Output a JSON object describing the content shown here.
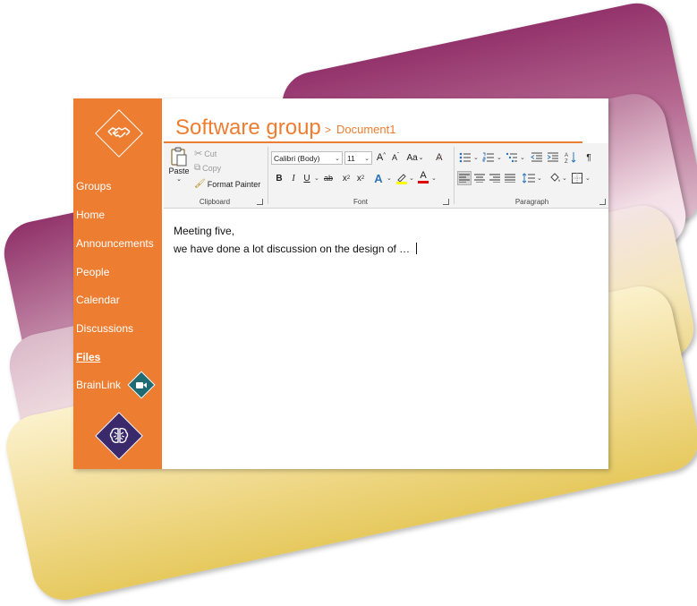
{
  "app": {
    "title": "Software group",
    "breadcrumb_sep": ">",
    "document": "Document1"
  },
  "sidebar": {
    "items": [
      {
        "label": "Groups"
      },
      {
        "label": "Home"
      },
      {
        "label": "Announcements"
      },
      {
        "label": "People"
      },
      {
        "label": "Calendar"
      },
      {
        "label": "Discussions"
      },
      {
        "label": "Files",
        "active": true
      },
      {
        "label": "BrainLink"
      }
    ],
    "top_logo_icon": "handshake-icon",
    "bottom_logo_icon": "brain-icon",
    "brainlink_badge_icon": "video-camera-icon"
  },
  "ribbon": {
    "clipboard": {
      "label": "Clipboard",
      "paste": "Paste",
      "cut": "Cut",
      "copy": "Copy",
      "format_painter": "Format Painter"
    },
    "font": {
      "label": "Font",
      "font_name": "Calibri (Body)",
      "font_size": "11",
      "bold": "B",
      "italic": "I",
      "underline": "U",
      "strikethrough": "ab",
      "subscript": "x",
      "superscript": "x",
      "change_case": "Aa",
      "text_effects": "A",
      "font_color": "A"
    },
    "paragraph": {
      "label": "Paragraph",
      "pilcrow": "¶"
    }
  },
  "document": {
    "lines": [
      "Meeting five,",
      "we have done a lot discussion on the design of … "
    ]
  },
  "colors": {
    "accent": "#ed7d31",
    "sidebar": "#ed7d31",
    "brain_logo": "#3b2a6b",
    "brainlink_badge": "#1f6b73",
    "card_plum": "#93336c",
    "card_gold": "#e6c95e"
  }
}
